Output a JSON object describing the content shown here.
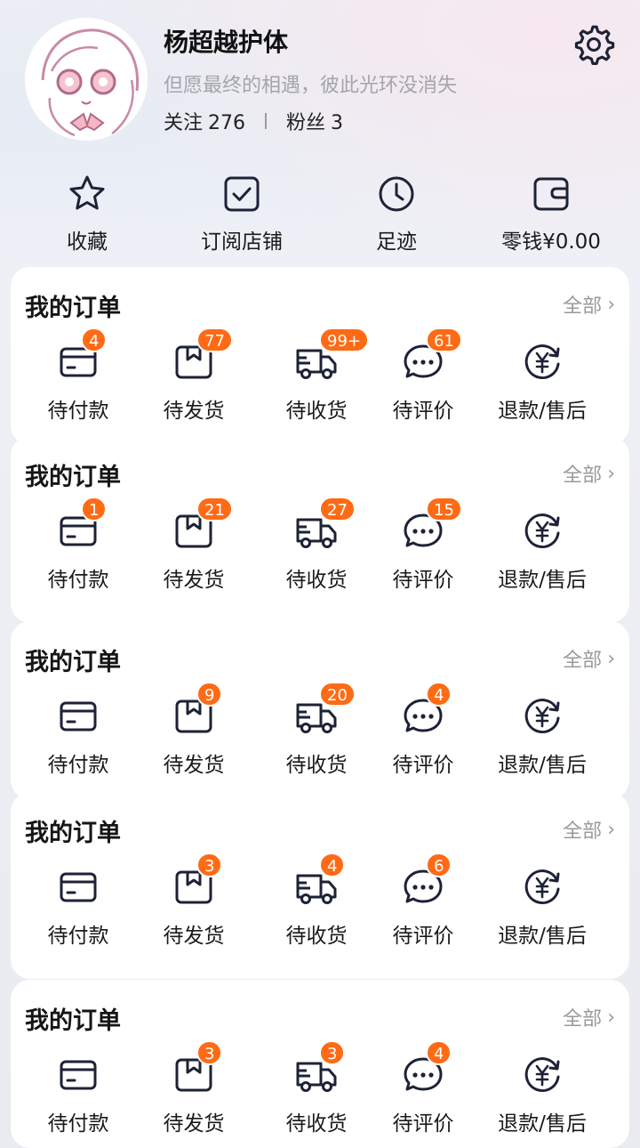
{
  "profile": {
    "name": "杨超越护体",
    "bio": "但愿最终的相遇，彼此光环没消失",
    "following_label": "关注",
    "following_count": "276",
    "followers_label": "粉丝",
    "followers_count": "3"
  },
  "quick_actions": [
    {
      "label": "收藏",
      "icon": "star-icon"
    },
    {
      "label": "订阅店铺",
      "icon": "checkbox-icon"
    },
    {
      "label": "足迹",
      "icon": "clock-icon"
    },
    {
      "label": "零钱¥0.00",
      "icon": "wallet-icon"
    }
  ],
  "order_item_labels": [
    "待付款",
    "待发货",
    "待收货",
    "待评价",
    "退款/售后"
  ],
  "cards": [
    {
      "title": "我的订单",
      "all_label": "全部",
      "badges": [
        "4",
        "77",
        "99+",
        "61",
        ""
      ]
    },
    {
      "title": "我的订单",
      "all_label": "全部",
      "badges": [
        "1",
        "21",
        "27",
        "15",
        ""
      ]
    },
    {
      "title": "我的订单",
      "all_label": "全部",
      "badges": [
        "",
        "9",
        "20",
        "4",
        ""
      ]
    },
    {
      "title": "我的订单",
      "all_label": "全部",
      "badges": [
        "",
        "3",
        "4",
        "6",
        ""
      ]
    },
    {
      "title": "我的订单",
      "all_label": "全部",
      "badges": [
        "",
        "3",
        "3",
        "4",
        ""
      ]
    }
  ],
  "colors": {
    "badge": "#ff6a14",
    "icon_stroke": "#1d2236",
    "muted": "#9a9a9a"
  }
}
